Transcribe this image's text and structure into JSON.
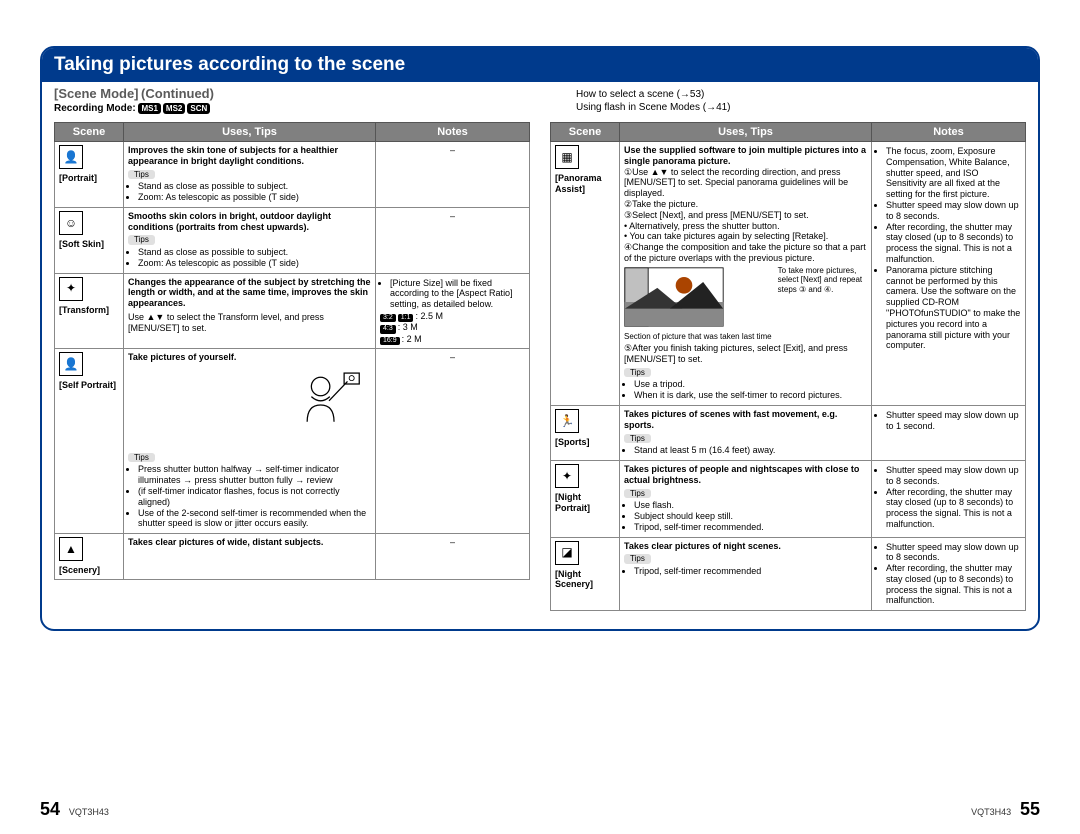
{
  "header": {
    "title": "Taking pictures according to the scene",
    "mode_label": "[Scene Mode]",
    "continued": "(Continued)",
    "recording_label": "Recording Mode:",
    "chips": [
      "MS1",
      "MS2",
      "SCN"
    ],
    "how_to": "How to select a scene (→53)",
    "flash": "Using flash in Scene Modes (→41)"
  },
  "th": {
    "scene": "Scene",
    "uses": "Uses, Tips",
    "notes": "Notes"
  },
  "tips_badge": "Tips",
  "left": [
    {
      "icon": "👤",
      "name": "[Portrait]",
      "bold": "Improves the skin tone of subjects for a healthier appearance in bright daylight conditions.",
      "tips": [
        "Stand as close as possible to subject.",
        "Zoom: As telescopic as possible (T side)"
      ],
      "notes": "–"
    },
    {
      "icon": "☺",
      "name": "[Soft Skin]",
      "bold": "Smooths skin colors in bright, outdoor daylight conditions (portraits from chest upwards).",
      "tips": [
        "Stand as close as possible to subject.",
        "Zoom: As telescopic as possible (T side)"
      ],
      "notes": "–"
    },
    {
      "icon": "✦",
      "name": "[Transform]",
      "bold": "Changes the appearance of the subject by stretching the length or width, and at the same time, improves the skin appearances.",
      "extra": "Use ▲▼ to select the Transform level, and press [MENU/SET] to set.",
      "notes_list": [
        "[Picture Size] will be fixed according to the [Aspect Ratio] setting, as detailed below."
      ],
      "ratios": [
        [
          "3:2",
          "1:1",
          "2.5 M"
        ],
        [
          "4:3",
          "",
          "3 M"
        ],
        [
          "16:9",
          "",
          "2 M"
        ]
      ]
    },
    {
      "icon": "👤",
      "name": "[Self Portrait]",
      "bold": "Take pictures of yourself.",
      "tips": [
        "Press shutter button halfway → self-timer indicator illuminates → press shutter button fully → review",
        "(if self-timer indicator flashes, focus is not correctly aligned)",
        "Use of the 2-second self-timer is recommended when the shutter speed is slow or jitter occurs easily."
      ],
      "notes": "–",
      "illus": "self"
    },
    {
      "icon": "▲",
      "name": "[Scenery]",
      "bold": "Takes clear pictures of wide, distant subjects.",
      "notes": "–"
    }
  ],
  "right": [
    {
      "icon": "▦",
      "name": "[Panorama Assist]",
      "bold": "Use the supplied software to join multiple pictures into a single panorama picture.",
      "steps": [
        "①Use ▲▼ to select the recording direction, and press [MENU/SET] to set. Special panorama guidelines will be displayed.",
        "②Take the picture.",
        "③Select [Next], and press [MENU/SET] to set.",
        "• Alternatively, press the shutter button.",
        "• You can take pictures again by selecting [Retake].",
        "④Change the composition and take the picture so that a part of the picture overlaps with the previous picture."
      ],
      "pan_hint": "To take more pictures, select [Next] and repeat steps ③ and ④.",
      "pan_caption": "Section of picture that was taken last time",
      "post": [
        "⑤After you finish taking pictures, select [Exit], and press [MENU/SET] to set."
      ],
      "tips": [
        "Use a tripod.",
        "When it is dark, use the self-timer to record pictures."
      ],
      "notes_list": [
        "The focus, zoom, Exposure Compensation, White Balance, shutter speed, and ISO Sensitivity are all fixed at the setting for the first picture.",
        "Shutter speed may slow down up to 8 seconds.",
        "After recording, the shutter may stay closed (up to 8 seconds) to process the signal. This is not a malfunction.",
        "Panorama picture stitching cannot be performed by this camera. Use the software on the supplied CD-ROM \"PHOTOfunSTUDIO\" to make the pictures you record into a panorama still picture with your computer."
      ]
    },
    {
      "icon": "🏃",
      "name": "[Sports]",
      "bold": "Takes pictures of scenes with fast movement, e.g. sports.",
      "tips": [
        "Stand at least 5 m (16.4 feet) away."
      ],
      "notes_list": [
        "Shutter speed may slow down up to 1 second."
      ]
    },
    {
      "icon": "✦",
      "name": "[Night Portrait]",
      "bold": "Takes pictures of people and nightscapes with close to actual brightness.",
      "tips": [
        "Use flash.",
        "Subject should keep still.",
        "Tripod, self-timer recommended."
      ],
      "notes_list": [
        "Shutter speed may slow down up to 8 seconds.",
        "After recording, the shutter may stay closed (up to 8 seconds) to process the signal. This is not a malfunction."
      ]
    },
    {
      "icon": "◪",
      "name": "[Night Scenery]",
      "bold": "Takes clear pictures of night scenes.",
      "tips": [
        "Tripod, self-timer recommended"
      ],
      "notes_list": [
        "Shutter speed may slow down up to 8 seconds.",
        "After recording, the shutter may stay closed (up to 8 seconds) to process the signal. This is not a malfunction."
      ]
    }
  ],
  "footer": {
    "pL": "54",
    "pR": "55",
    "code": "VQT3H43"
  }
}
